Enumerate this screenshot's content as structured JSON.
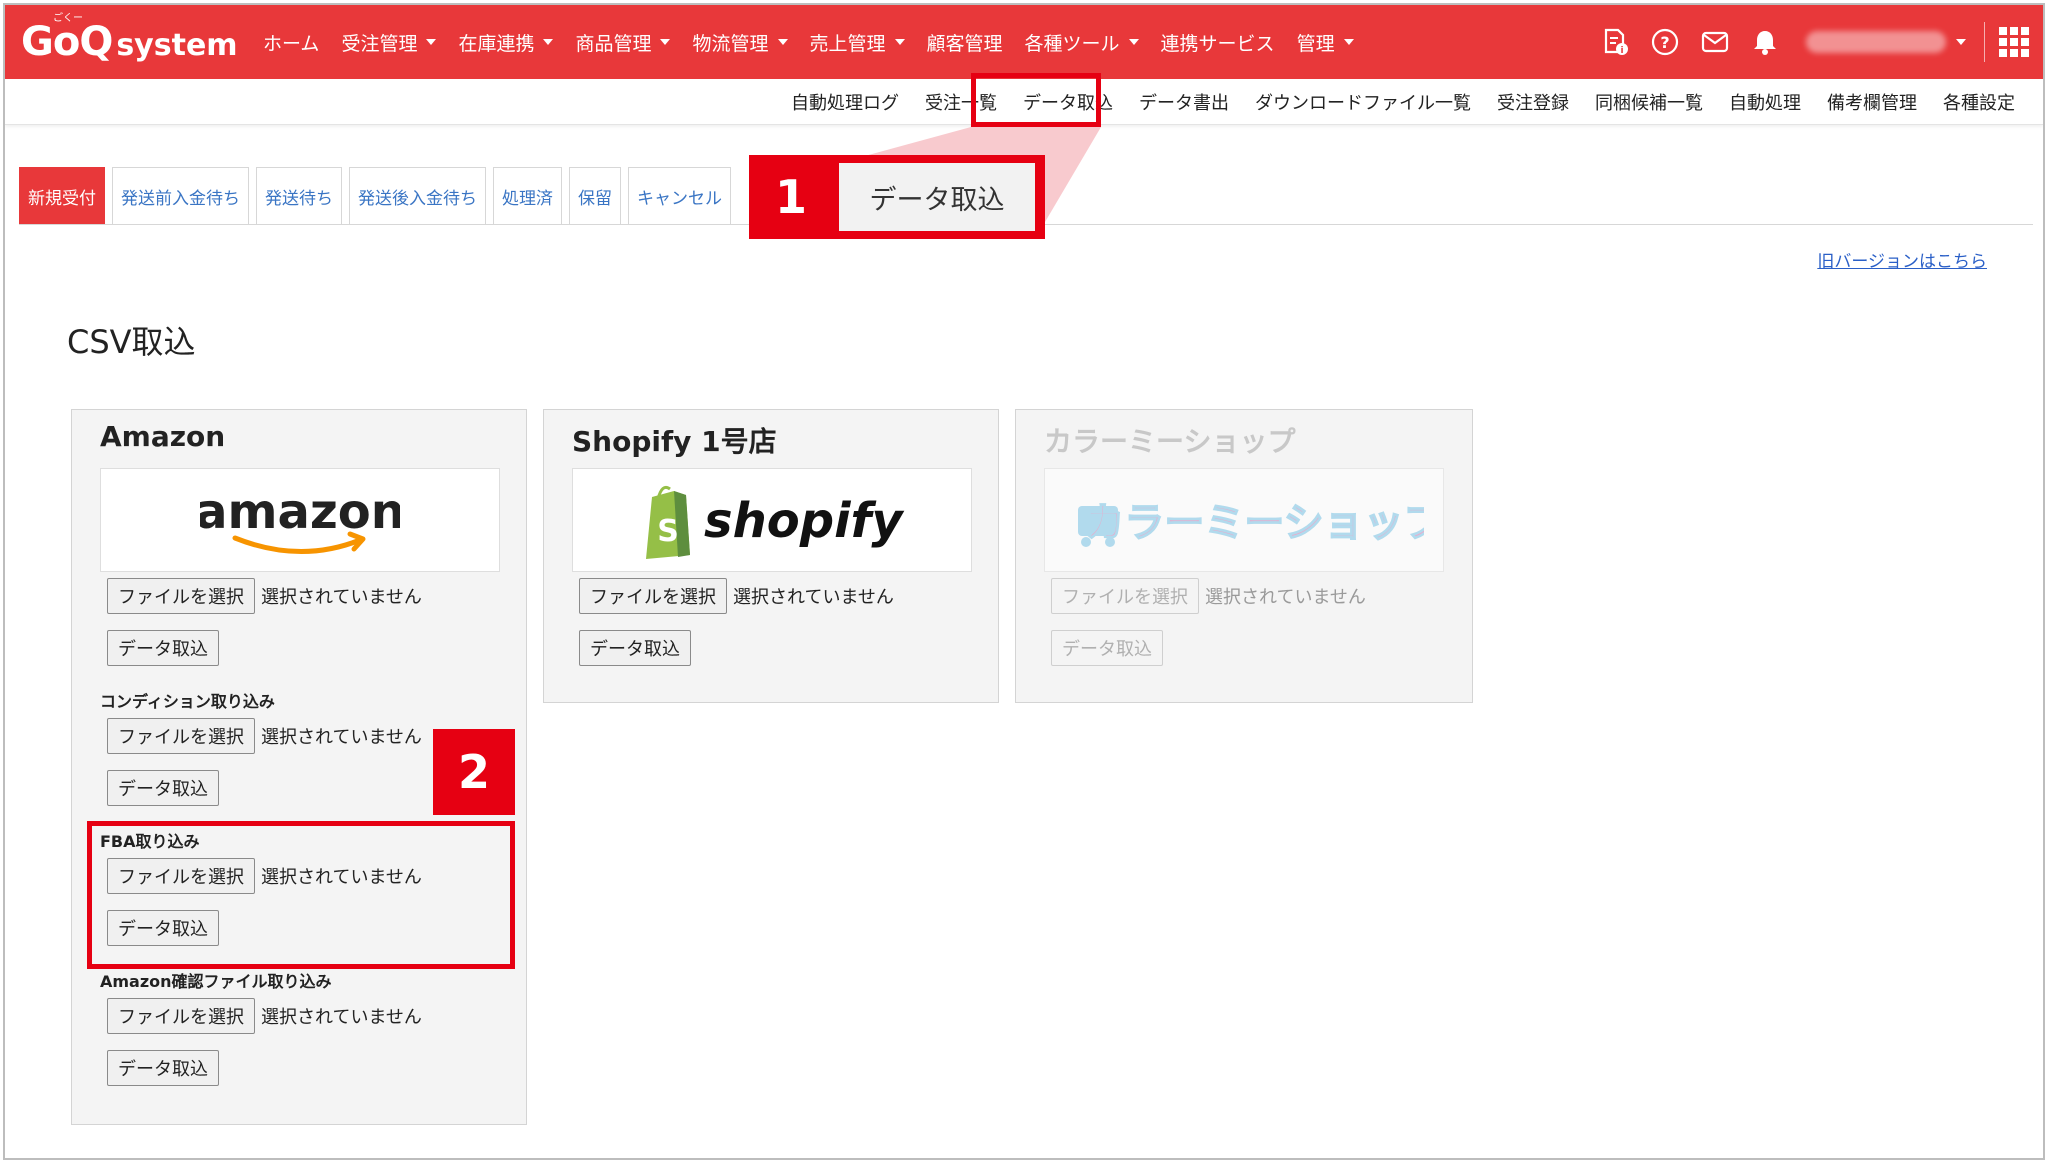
{
  "brand": {
    "logo_main": "GoQ",
    "logo_sub": "system",
    "logo_ruby": "ごくー",
    "accent": "#e8383a",
    "highlight": "#e60012"
  },
  "nav": {
    "items": [
      {
        "label": "ホーム",
        "dropdown": false
      },
      {
        "label": "受注管理",
        "dropdown": true
      },
      {
        "label": "在庫連携",
        "dropdown": true
      },
      {
        "label": "商品管理",
        "dropdown": true
      },
      {
        "label": "物流管理",
        "dropdown": true
      },
      {
        "label": "売上管理",
        "dropdown": true
      },
      {
        "label": "顧客管理",
        "dropdown": false
      },
      {
        "label": "各種ツール",
        "dropdown": true
      },
      {
        "label": "連携サービス",
        "dropdown": false
      },
      {
        "label": "管理",
        "dropdown": true
      }
    ],
    "icons": [
      "report-icon",
      "help-icon",
      "mail-icon",
      "bell-icon",
      "apps-grid-icon"
    ]
  },
  "subnav": {
    "items": [
      "自動処理ログ",
      "受注一覧",
      "データ取込",
      "データ書出",
      "ダウンロードファイル一覧",
      "受注登録",
      "同梱候補一覧",
      "自動処理",
      "備考欄管理",
      "各種設定"
    ],
    "active": "データ取込"
  },
  "tabs": [
    "新規受付",
    "発送前入金待ち",
    "発送待ち",
    "発送後入金待ち",
    "処理済",
    "保留",
    "キャンセル"
  ],
  "callout1": {
    "number": "1",
    "label": "データ取込"
  },
  "callout2": {
    "number": "2"
  },
  "old_version_link": "旧バージョンはこちら",
  "page_title": "CSV取込",
  "cards": {
    "amazon": {
      "title": "Amazon",
      "logo_text": "amazon",
      "file_button": "ファイルを選択",
      "no_file": "選択されていません",
      "import_button": "データ取込",
      "sections": [
        {
          "label": "コンディション取り込み",
          "file_button": "ファイルを選択",
          "no_file": "選択されていません",
          "import_button": "データ取込"
        },
        {
          "label": "FBA取り込み",
          "file_button": "ファイルを選択",
          "no_file": "選択されていません",
          "import_button": "データ取込"
        },
        {
          "label": "Amazon確認ファイル取り込み",
          "file_button": "ファイルを選択",
          "no_file": "選択されていません",
          "import_button": "データ取込"
        }
      ]
    },
    "shopify": {
      "title": "Shopify 1号店",
      "logo_text": "shopify",
      "file_button": "ファイルを選択",
      "no_file": "選択されていません",
      "import_button": "データ取込"
    },
    "colorme": {
      "title": "カラーミーショップ",
      "logo_text": "カラーミーショップ",
      "file_button": "ファイルを選択",
      "no_file": "選択されていません",
      "import_button": "データ取込",
      "disabled": true
    }
  }
}
